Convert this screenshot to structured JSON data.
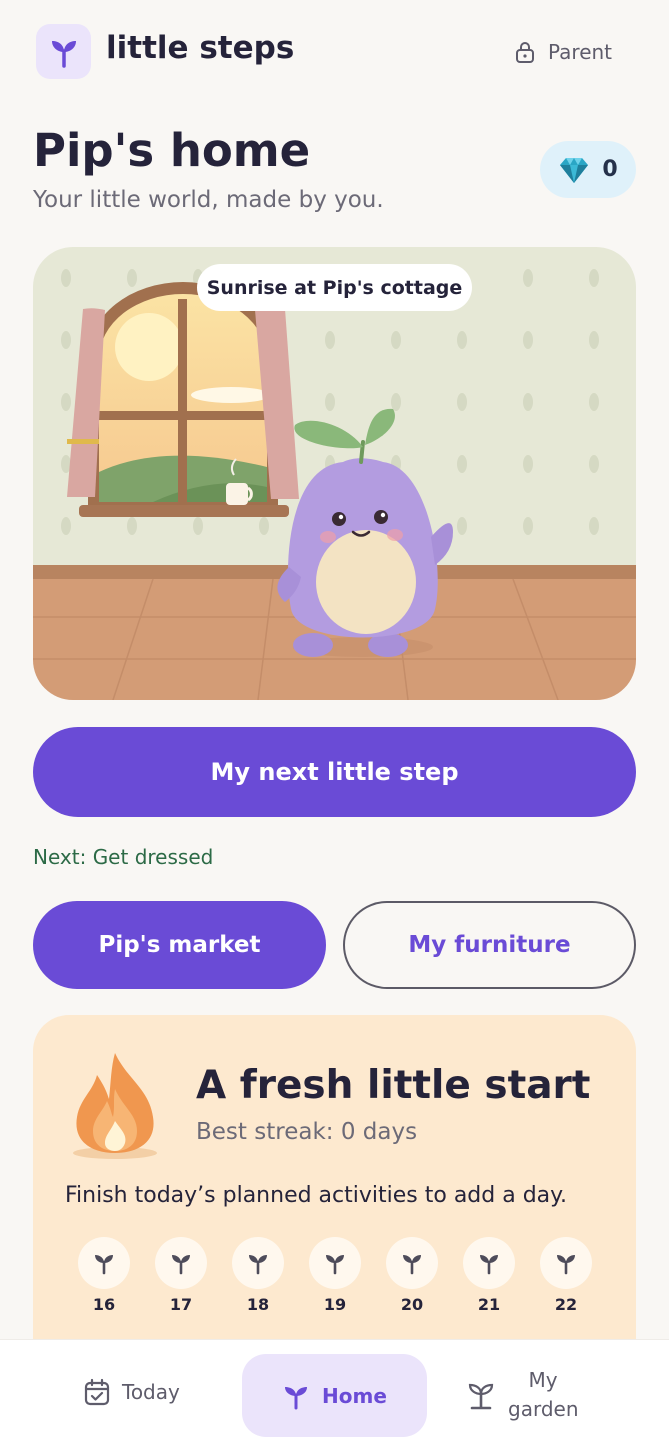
{
  "header": {
    "app_name": "little steps",
    "parent_label": "Parent"
  },
  "home": {
    "title": "Pip's home",
    "subtitle": "Your little world, made by you.",
    "gem_count": "0",
    "scene_label": "Sunrise at Pip's cottage"
  },
  "actions": {
    "next_step_label": "My next little step",
    "next_text": "Next: Get dressed",
    "market_label": "Pip's market",
    "furniture_label": "My furniture"
  },
  "streak": {
    "title": "A fresh little start",
    "best": "Best streak: 0 days",
    "description": "Finish today’s planned activities to add a day.",
    "days": [
      "16",
      "17",
      "18",
      "19",
      "20",
      "21",
      "22"
    ]
  },
  "nav": {
    "today": "Today",
    "home": "Home",
    "garden": "My garden"
  },
  "colors": {
    "accent": "#6a4bd6",
    "accent_soft": "#ebe4fb",
    "streak_bg": "#fde9cf",
    "gem_bg": "#dff1fa",
    "next_text": "#2c6a46"
  }
}
